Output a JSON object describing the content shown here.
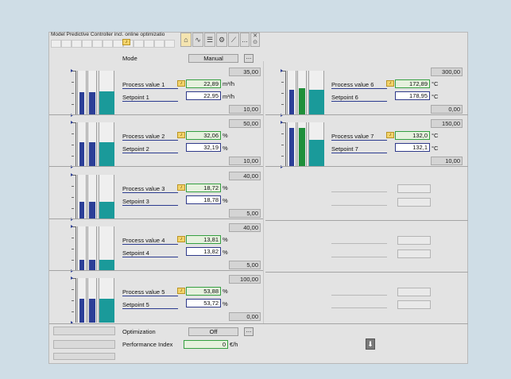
{
  "window": {
    "title": "Model Predictive Controller incl. online optimizatio"
  },
  "toolbar": {
    "icons": [
      "home-icon",
      "trend-icon",
      "list-icon",
      "parameter-icon",
      "ramp-icon",
      "more-icon",
      "close-icon"
    ],
    "more_label": "..."
  },
  "mode": {
    "label": "Mode",
    "value": "Manual",
    "more": "..."
  },
  "loops_left": [
    {
      "pv_label": "Process value 1",
      "pv": "22,89",
      "sp_label": "Setpoint 1",
      "sp": "22,95",
      "unit": "m³/h",
      "high": "35,00",
      "low": "10,00",
      "pv_frac": 0.51,
      "sp_frac": 0.52,
      "bar_frac": 0.53
    },
    {
      "pv_label": "Process value 2",
      "pv": "32,06",
      "sp_label": "Setpoint 2",
      "sp": "32,19",
      "unit": "%",
      "high": "50,00",
      "low": "10,00",
      "pv_frac": 0.55,
      "sp_frac": 0.55,
      "bar_frac": 0.55
    },
    {
      "pv_label": "Process value 3",
      "pv": "18,72",
      "sp_label": "Setpoint 3",
      "sp": "18,78",
      "unit": "%",
      "high": "40,00",
      "low": "5,00",
      "pv_frac": 0.39,
      "sp_frac": 0.39,
      "bar_frac": 0.39
    },
    {
      "pv_label": "Process value 4",
      "pv": "13,81",
      "sp_label": "Setpoint 4",
      "sp": "13,82",
      "unit": "%",
      "high": "40,00",
      "low": "5,00",
      "pv_frac": 0.25,
      "sp_frac": 0.25,
      "bar_frac": 0.25
    },
    {
      "pv_label": "Process value 5",
      "pv": "53,88",
      "sp_label": "Setpoint 5",
      "sp": "53,72",
      "unit": "%",
      "high": "100,00",
      "low": "0,00",
      "pv_frac": 0.54,
      "sp_frac": 0.54,
      "bar_frac": 0.54
    }
  ],
  "loops_right": [
    {
      "pv_label": "Process value 6",
      "pv": "172,89",
      "sp_label": "Setpoint 6",
      "sp": "178,95",
      "unit": "°C",
      "high": "300,00",
      "low": "0,00",
      "pv_frac": 0.58,
      "sp_frac": 0.6,
      "bar_frac": 0.58
    },
    {
      "pv_label": "Process value 7",
      "pv": "132,0",
      "sp_label": "Setpoint 7",
      "sp": "132,1",
      "unit": "°C",
      "high": "150,00",
      "low": "10,00",
      "pv_frac": 0.87,
      "sp_frac": 0.87,
      "bar_frac": 0.6
    }
  ],
  "optimization": {
    "label": "Optimization",
    "value": "Off",
    "more": "..."
  },
  "performance": {
    "label": "Performance Index",
    "value": "0",
    "unit": "€/h"
  },
  "alarm_icon": "alarm-bell-icon",
  "download_icon": "download-arrow-icon",
  "colors": {
    "pv": "#35a041",
    "sp": "#2f3a8a",
    "bar_blue": "#2c3f97",
    "bar_green": "#1f8f3a",
    "bar_teal": "#1a9a9a"
  }
}
